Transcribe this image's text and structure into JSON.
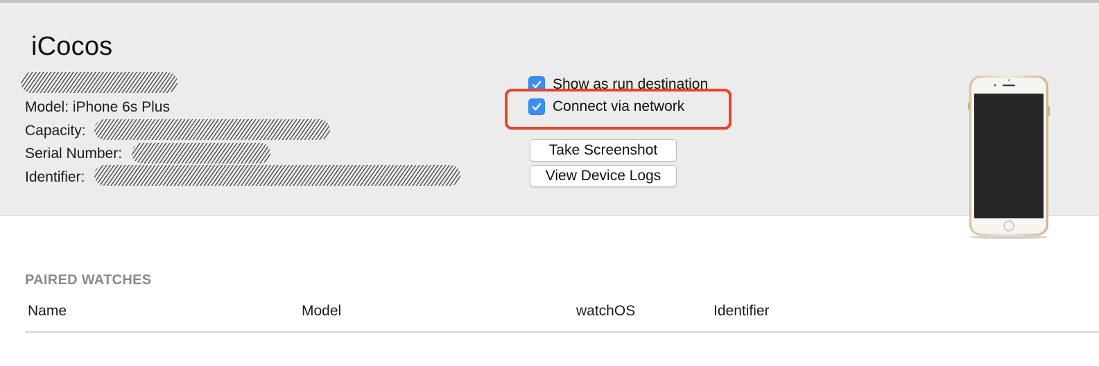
{
  "device": {
    "name": "iCocos",
    "model_label": "Model:",
    "model_value": "iPhone 6s Plus",
    "capacity_label": "Capacity:",
    "serial_label": "Serial Number:",
    "identifier_label": "Identifier:"
  },
  "options": {
    "show_run_destination": {
      "label": "Show as run destination",
      "checked": true
    },
    "connect_network": {
      "label": "Connect via network",
      "checked": true
    }
  },
  "buttons": {
    "take_screenshot": "Take Screenshot",
    "view_logs": "View Device Logs"
  },
  "paired_watches": {
    "title": "PAIRED WATCHES",
    "columns": [
      "Name",
      "Model",
      "watchOS",
      "Identifier"
    ]
  },
  "colors": {
    "panel_bg": "#ececec",
    "checkbox_blue": "#3a8ef0",
    "highlight_red": "#e9432b",
    "section_gray": "#8a8a8a"
  }
}
